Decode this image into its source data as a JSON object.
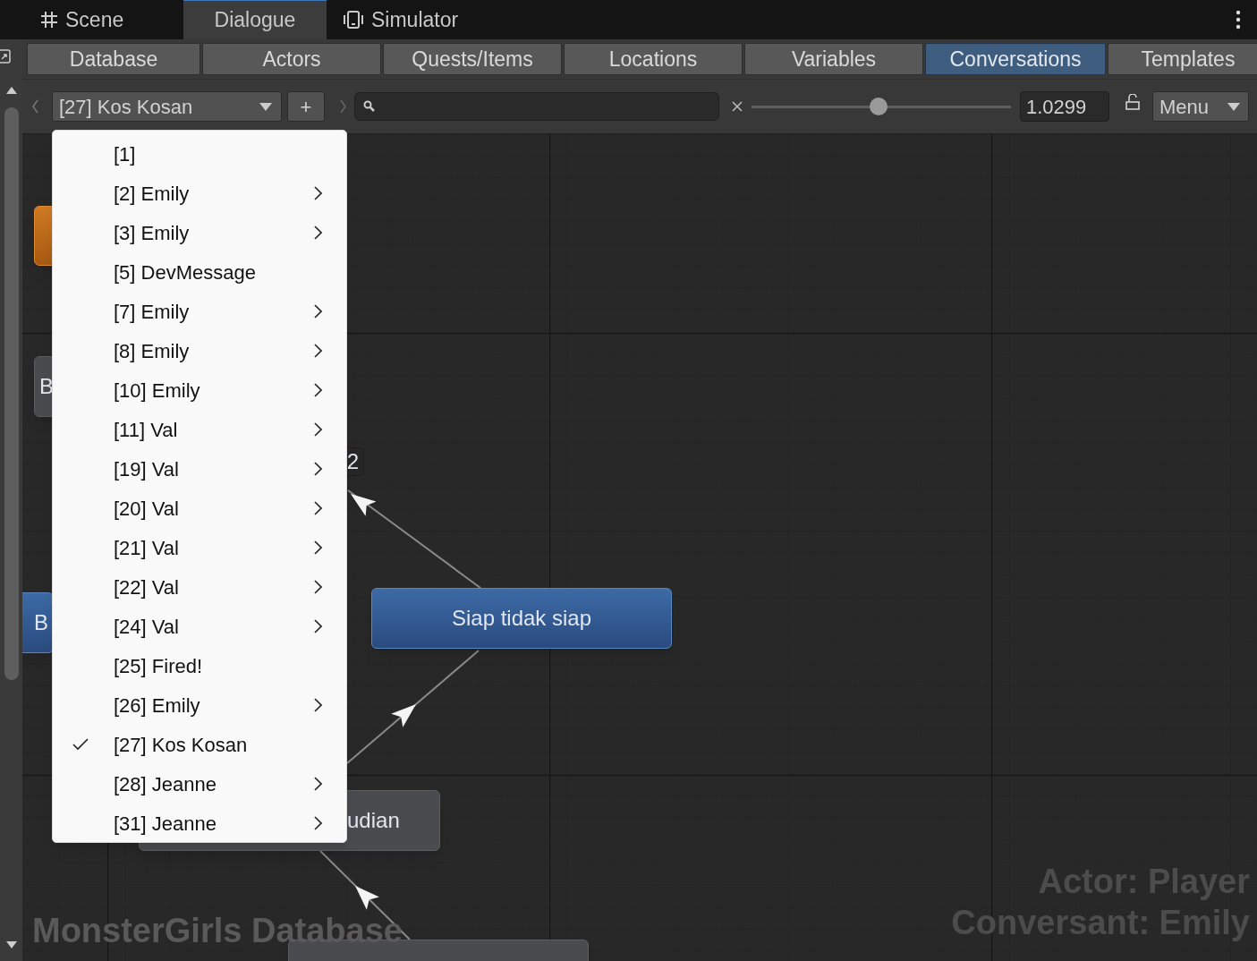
{
  "window_tabs": [
    {
      "label": "Scene",
      "kind": "scene",
      "selected": false
    },
    {
      "label": "Dialogue",
      "kind": "plain",
      "selected": true
    },
    {
      "label": "Simulator",
      "kind": "simulator",
      "selected": false
    }
  ],
  "section_tabs": [
    {
      "label": "Database",
      "selected": false
    },
    {
      "label": "Actors",
      "selected": false
    },
    {
      "label": "Quests/Items",
      "selected": false
    },
    {
      "label": "Locations",
      "selected": false
    },
    {
      "label": "Variables",
      "selected": false
    },
    {
      "label": "Conversations",
      "selected": true
    },
    {
      "label": "Templates",
      "selected": false
    }
  ],
  "toolbar": {
    "conversation": "[27] Kos Kosan",
    "add": "+",
    "zoom": {
      "level": 0.49,
      "value": "1.0299"
    },
    "menu": "Menu"
  },
  "nodes": [
    {
      "kind": "orange"
    },
    {
      "kind": "gray",
      "text": "B"
    },
    {
      "kind": "label",
      "text": "2"
    },
    {
      "kind": "blue",
      "text": "B"
    },
    {
      "kind": "blue",
      "text": "Siap tidak siap"
    },
    {
      "kind": "gray",
      "text": "udian"
    },
    {
      "kind": "gray"
    }
  ],
  "overlay": {
    "database": "MonsterGirls Database",
    "actor": "Actor: Player",
    "conversant": "Conversant: Emily"
  },
  "menu_items": [
    {
      "label": "[1]",
      "submenu": false,
      "checked": false
    },
    {
      "label": "[2] Emily",
      "submenu": true,
      "checked": false
    },
    {
      "label": "[3] Emily",
      "submenu": true,
      "checked": false
    },
    {
      "label": "[5] DevMessage",
      "submenu": false,
      "checked": false
    },
    {
      "label": "[7] Emily",
      "submenu": true,
      "checked": false
    },
    {
      "label": "[8] Emily",
      "submenu": true,
      "checked": false
    },
    {
      "label": "[10] Emily",
      "submenu": true,
      "checked": false
    },
    {
      "label": "[11] Val",
      "submenu": true,
      "checked": false
    },
    {
      "label": "[19] Val",
      "submenu": true,
      "checked": false
    },
    {
      "label": "[20] Val",
      "submenu": true,
      "checked": false
    },
    {
      "label": "[21] Val",
      "submenu": true,
      "checked": false
    },
    {
      "label": "[22] Val",
      "submenu": true,
      "checked": false
    },
    {
      "label": "[24] Val",
      "submenu": true,
      "checked": false
    },
    {
      "label": "[25] Fired!",
      "submenu": false,
      "checked": false
    },
    {
      "label": "[26] Emily",
      "submenu": true,
      "checked": false
    },
    {
      "label": "[27] Kos Kosan",
      "submenu": false,
      "checked": true
    },
    {
      "label": "[28] Jeanne",
      "submenu": true,
      "checked": false
    },
    {
      "label": "[31] Jeanne",
      "submenu": true,
      "checked": false
    }
  ]
}
